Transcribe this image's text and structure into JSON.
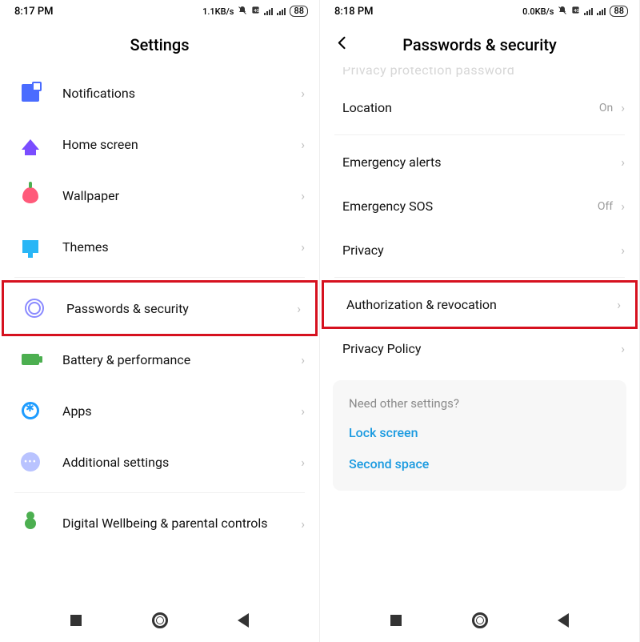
{
  "left": {
    "status": {
      "time": "8:17 PM",
      "net": "1.1KB/s",
      "gen": "4G",
      "battery": "88"
    },
    "title": "Settings",
    "items": {
      "notifications": "Notifications",
      "home": "Home screen",
      "wallpaper": "Wallpaper",
      "themes": "Themes",
      "passwords": "Passwords & security",
      "battery": "Battery & performance",
      "apps": "Apps",
      "additional": "Additional settings",
      "wellbeing": "Digital Wellbeing & parental controls"
    }
  },
  "right": {
    "status": {
      "time": "8:18 PM",
      "net": "0.0KB/s",
      "gen": "4G",
      "battery": "88"
    },
    "title": "Passwords & security",
    "cutoff": "Privacy protection password",
    "items": {
      "location": {
        "label": "Location",
        "value": "On"
      },
      "emergency_alerts": {
        "label": "Emergency alerts"
      },
      "emergency_sos": {
        "label": "Emergency SOS",
        "value": "Off"
      },
      "privacy": {
        "label": "Privacy"
      },
      "authorization": {
        "label": "Authorization & revocation"
      },
      "privacy_policy": {
        "label": "Privacy Policy"
      }
    },
    "card": {
      "title": "Need other settings?",
      "link1": "Lock screen",
      "link2": "Second space"
    }
  }
}
